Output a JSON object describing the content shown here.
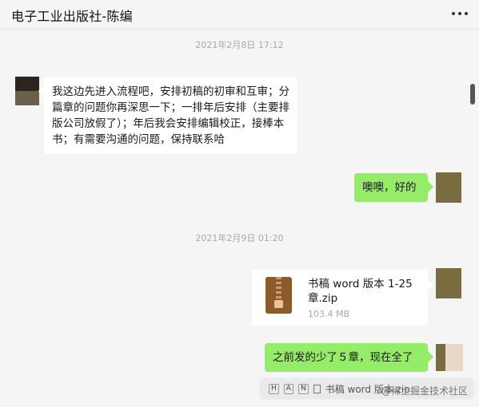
{
  "header": {
    "title": "电子工业出版社-陈编"
  },
  "messages": {
    "ts1": "2021年2月8日 17:12",
    "msg1": "我这边先进入流程吧，安排初稿的初审和互审；分篇章的问题你再深思一下；一排年后安排（主要排版公司放假了）；年后我会安排编辑校正，接棒本书；有需要沟通的问题，保持联系哈",
    "msg2": "噢噢，好的",
    "ts2": "2021年2月9日 01:20",
    "file": {
      "name": "书稿 word 版本 1-25章.zip",
      "size": "103.4 MB",
      "icon": "zip-file-icon"
    },
    "msg3": "之前发的少了５章，现在全了"
  },
  "tooltip": {
    "key1": "H",
    "key2": "A",
    "key3": "N",
    "text": "书稿 word 版本.zip"
  },
  "watermark": "@稀土掘金技术社区",
  "colors": {
    "bubble_out": "#95ec69",
    "bubble_in": "#ffffff",
    "background": "#f5f5f5"
  }
}
